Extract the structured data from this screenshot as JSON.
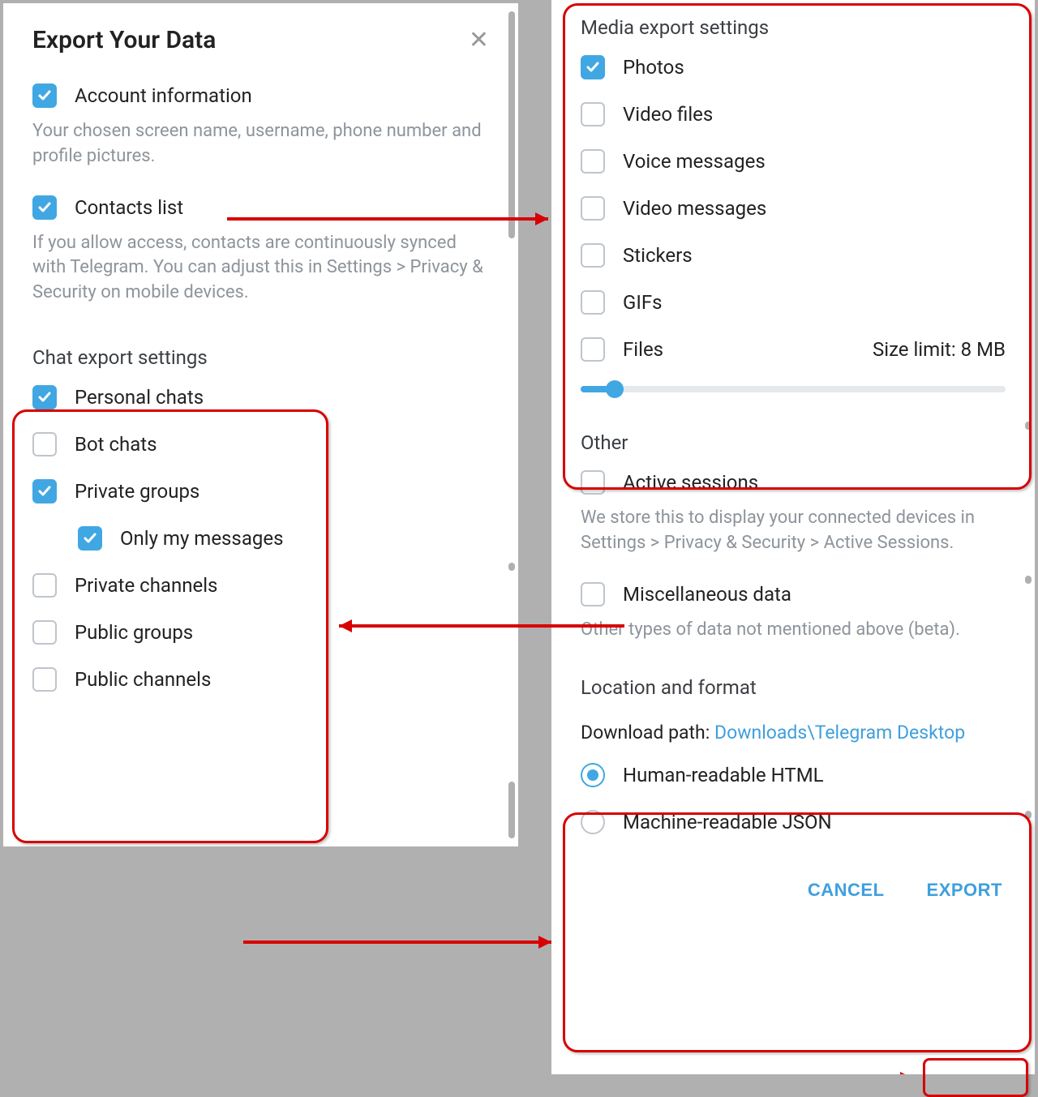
{
  "dialog": {
    "title": "Export Your Data"
  },
  "account": {
    "label": "Account information",
    "description": "Your chosen screen name, username, phone number and profile pictures."
  },
  "contacts": {
    "label": "Contacts list",
    "description": "If you allow access, contacts are continuously synced with Telegram. You can adjust this in Settings > Privacy & Security on mobile devices."
  },
  "chat_export": {
    "title": "Chat export settings",
    "personal_chats": "Personal chats",
    "bot_chats": "Bot chats",
    "private_groups": "Private groups",
    "only_my_messages": "Only my messages",
    "private_channels": "Private channels",
    "public_groups": "Public groups",
    "public_channels": "Public channels"
  },
  "media_export": {
    "title": "Media export settings",
    "photos": "Photos",
    "video_files": "Video files",
    "voice_messages": "Voice messages",
    "video_messages": "Video messages",
    "stickers": "Stickers",
    "gifs": "GIFs",
    "files": "Files",
    "size_limit": "Size limit: 8 MB"
  },
  "other": {
    "title": "Other",
    "active_sessions": "Active sessions",
    "active_sessions_desc": "We store this to display your connected devices in Settings > Privacy & Security > Active Sessions.",
    "misc_data": "Miscellaneous data",
    "misc_desc": "Other types of data not mentioned above (beta)."
  },
  "location": {
    "title": "Location and format",
    "download_path_label": "Download path:",
    "download_path_value": "Downloads\\Telegram Desktop",
    "html": "Human-readable HTML",
    "json": "Machine-readable JSON"
  },
  "buttons": {
    "cancel": "CANCEL",
    "export": "EXPORT"
  }
}
